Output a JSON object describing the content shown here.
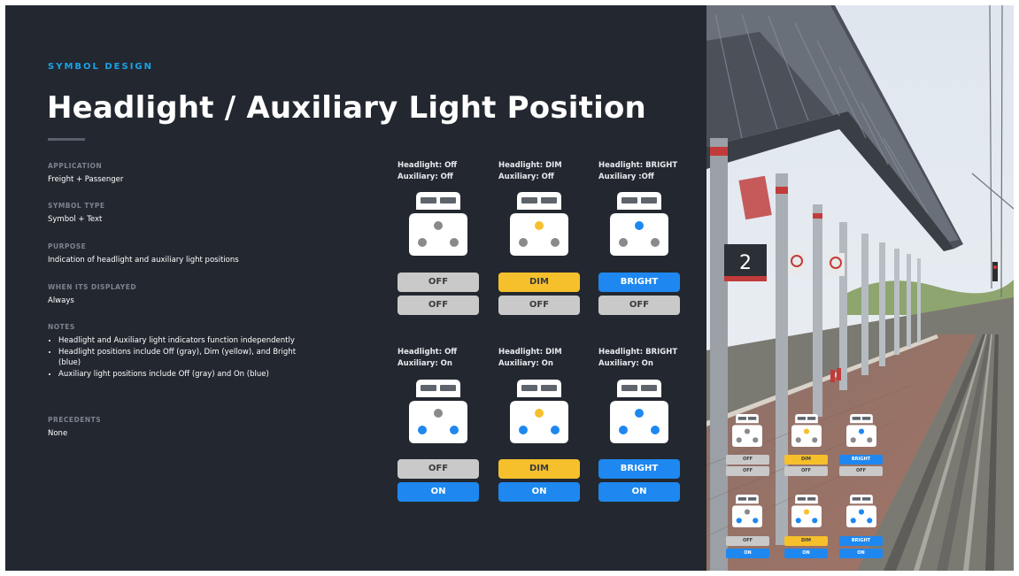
{
  "slide": {
    "eyebrow": "SYMBOL DESIGN",
    "title": "Headlight / Auxiliary Light Position"
  },
  "details": {
    "application": {
      "label": "APPLICATION",
      "value": "Freight + Passenger"
    },
    "symbol_type": {
      "label": "SYMBOL TYPE",
      "value": "Symbol + Text"
    },
    "purpose": {
      "label": "PURPOSE",
      "value": "Indication of headlight and auxiliary light positions"
    },
    "when_displayed": {
      "label": "WHEN ITS DISPLAYED",
      "value": "Always"
    },
    "notes": {
      "label": "NOTES",
      "items": [
        "Headlight and Auxiliary light indicators function independently",
        "Headlight positions include Off (gray), Dim (yellow), and Bright (blue)",
        "Auxiliary light positions include Off (gray) and On (blue)"
      ]
    },
    "precedents": {
      "label": "PRECEDENTS",
      "value": "None"
    }
  },
  "symbols": {
    "row1": [
      {
        "line1": "Headlight: Off",
        "line2": "Auxiliary: Off",
        "headlight": "OFF",
        "auxiliary": "OFF",
        "head_color": "gray",
        "aux_color": "gray"
      },
      {
        "line1": "Headlight: DIM",
        "line2": "Auxiliary: Off",
        "headlight": "DIM",
        "auxiliary": "OFF",
        "head_color": "yellow",
        "aux_color": "gray"
      },
      {
        "line1": "Headlight: BRIGHT",
        "line2": "Auxiliary :Off",
        "headlight": "BRIGHT",
        "auxiliary": "OFF",
        "head_color": "blue",
        "aux_color": "gray"
      }
    ],
    "row2": [
      {
        "line1": "Headlight: Off",
        "line2": "Auxiliary: On",
        "headlight": "OFF",
        "auxiliary": "ON",
        "head_color": "gray",
        "aux_color": "blue"
      },
      {
        "line1": "Headlight: DIM",
        "line2": "Auxiliary: On",
        "headlight": "DIM",
        "auxiliary": "ON",
        "head_color": "yellow",
        "aux_color": "blue"
      },
      {
        "line1": "Headlight: BRIGHT",
        "line2": "Auxiliary: On",
        "headlight": "BRIGHT",
        "auxiliary": "ON",
        "head_color": "blue",
        "aux_color": "blue"
      }
    ]
  },
  "photo": {
    "platform_number": "2",
    "mini_labels": {
      "row1": [
        [
          "OFF",
          "OFF"
        ],
        [
          "DIM",
          "OFF"
        ],
        [
          "BRIGHT",
          "OFF"
        ]
      ],
      "row2": [
        [
          "OFF",
          "ON"
        ],
        [
          "DIM",
          "ON"
        ],
        [
          "BRIGHT",
          "ON"
        ]
      ]
    }
  },
  "colors": {
    "background": "#232830",
    "accent": "#1aa3e8",
    "off_gray": "#c9c9c9",
    "dim_yellow": "#f5c02c",
    "bright_blue": "#1e88f0"
  }
}
